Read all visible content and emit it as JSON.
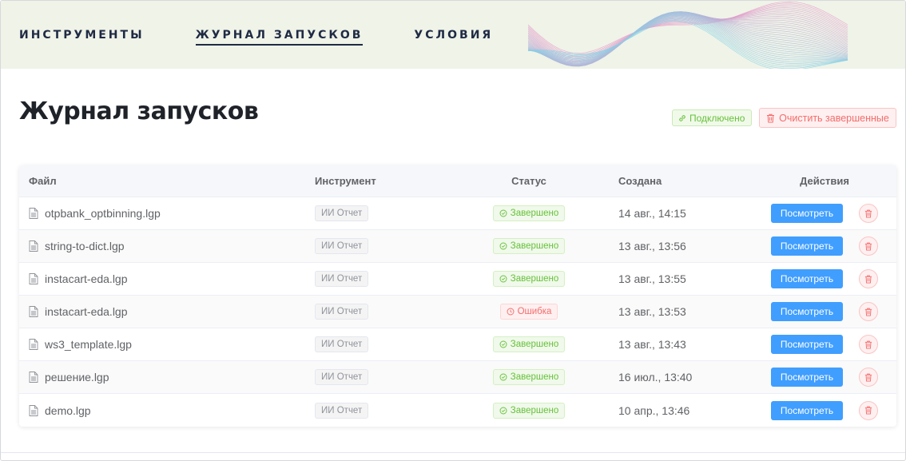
{
  "nav": {
    "items": [
      {
        "label": "ИНСТРУМЕНТЫ",
        "active": false
      },
      {
        "label": "ЖУРНАЛ ЗАПУСКОВ",
        "active": true
      },
      {
        "label": "УСЛОВИЯ",
        "active": false
      }
    ]
  },
  "page": {
    "title": "Журнал запусков",
    "connection_status": "Подключено",
    "clear_button_label": "Очистить завершенные"
  },
  "table": {
    "headers": {
      "file": "Файл",
      "tool": "Инструмент",
      "status": "Статус",
      "created": "Создана",
      "actions": "Действия"
    },
    "view_label": "Посмотреть",
    "rows": [
      {
        "file": "otpbank_optbinning.lgp",
        "tool": "ИИ Отчет",
        "status": "Завершено",
        "status_type": "success",
        "created": "14 авг., 14:15"
      },
      {
        "file": "string-to-dict.lgp",
        "tool": "ИИ Отчет",
        "status": "Завершено",
        "status_type": "success",
        "created": "13 авг., 13:56"
      },
      {
        "file": "instacart-eda.lgp",
        "tool": "ИИ Отчет",
        "status": "Завершено",
        "status_type": "success",
        "created": "13 авг., 13:55"
      },
      {
        "file": "instacart-eda.lgp",
        "tool": "ИИ Отчет",
        "status": "Ошибка",
        "status_type": "error",
        "created": "13 авг., 13:53"
      },
      {
        "file": "ws3_template.lgp",
        "tool": "ИИ Отчет",
        "status": "Завершено",
        "status_type": "success",
        "created": "13 авг., 13:43"
      },
      {
        "file": "решение.lgp",
        "tool": "ИИ Отчет",
        "status": "Завершено",
        "status_type": "success",
        "created": "16 июл., 13:40"
      },
      {
        "file": "demo.lgp",
        "tool": "ИИ Отчет",
        "status": "Завершено",
        "status_type": "success",
        "created": "10 апр., 13:46"
      }
    ]
  },
  "colors": {
    "primary": "#409eff",
    "success": "#67c23a",
    "danger": "#f56c6c",
    "nav_bg": "#eff3e8",
    "nav_text": "#1f2a44"
  },
  "icons": {
    "file": "document-icon",
    "success": "check-circle-icon",
    "error": "clock-circle-icon",
    "connected": "link-icon",
    "delete": "trash-icon"
  }
}
